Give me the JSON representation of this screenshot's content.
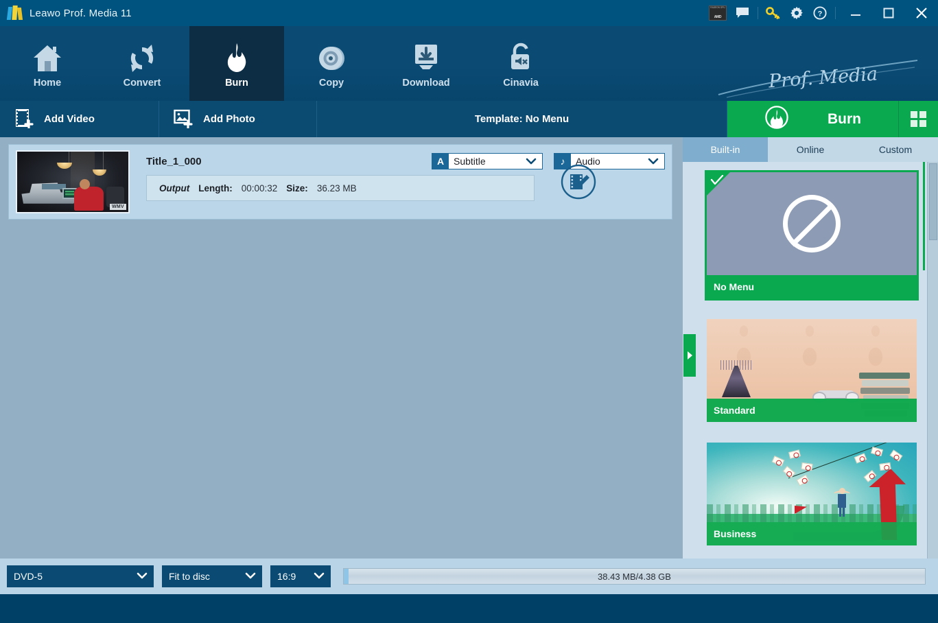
{
  "window": {
    "title": "Leawo Prof. Media 11",
    "logo_icon": "leawo-logo-icon",
    "controls": {
      "amd_badge_top": "RADEON GPU",
      "amd_badge_bottom": "AMD",
      "feedback_icon": "chat-bubble-icon",
      "key_icon": "key-icon",
      "settings_icon": "gear-icon",
      "help_icon": "help-circle-icon",
      "minimize_icon": "minimize-icon",
      "maximize_icon": "maximize-icon",
      "close_icon": "close-icon"
    }
  },
  "nav": {
    "items": [
      {
        "label": "Home",
        "icon": "home-icon",
        "active": false
      },
      {
        "label": "Convert",
        "icon": "convert-refresh-icon",
        "active": false
      },
      {
        "label": "Burn",
        "icon": "flame-icon",
        "active": true
      },
      {
        "label": "Copy",
        "icon": "disc-icon",
        "active": false
      },
      {
        "label": "Download",
        "icon": "download-monitor-icon",
        "active": false
      },
      {
        "label": "Cinavia",
        "icon": "unlock-mute-icon",
        "active": false
      }
    ],
    "brand": "Prof. Media"
  },
  "toolbar": {
    "add_video": "Add Video",
    "add_video_icon": "film-add-icon",
    "add_photo": "Add Photo",
    "add_photo_icon": "image-add-icon",
    "template_status": "Template: No Menu",
    "burn_label": "Burn",
    "burn_icon": "flame-circle-icon",
    "grid_icon": "grid-view-icon"
  },
  "video_item": {
    "title": "Title_1_000",
    "thumbnail_watermark": "WMV",
    "subtitle_select": {
      "badge": "A",
      "value": "Subtitle",
      "icon": "subtitle-icon"
    },
    "audio_select": {
      "badge": "♪",
      "value": "Audio",
      "icon": "audio-note-icon"
    },
    "output_label": "Output",
    "length_label": "Length:",
    "length_value": "00:00:32",
    "size_label": "Size:",
    "size_value": "36.23 MB",
    "edit_icon": "video-edit-icon"
  },
  "panel": {
    "handle_icon": "collapse-panel-arrow-icon",
    "tabs": [
      {
        "label": "Built-in",
        "active": true
      },
      {
        "label": "Online",
        "active": false
      },
      {
        "label": "Custom",
        "active": false
      }
    ],
    "templates": [
      {
        "name": "No Menu",
        "selected": true,
        "art": "nomenu",
        "icon": "no-entry-icon"
      },
      {
        "name": "Standard",
        "selected": false,
        "art": "standard"
      },
      {
        "name": "Business",
        "selected": false,
        "art": "business"
      }
    ]
  },
  "bottom": {
    "disc_type": "DVD-5",
    "fit_mode": "Fit to disc",
    "aspect_ratio": "16:9",
    "capacity_text": "38.43 MB/4.38 GB",
    "capacity_used": "38.43 MB",
    "capacity_total": "4.38 GB",
    "capacity_percent": 0.86
  },
  "colors": {
    "titlebar": "#00537f",
    "nav": "#0a4a73",
    "nav_active": "#0c2d44",
    "accent_green": "#0aa94f",
    "list_bg": "#93afc4",
    "card_bg": "#bbd6e8",
    "panel_bg": "#cfe0ec",
    "bottom_bar": "#b9d4e6",
    "status_bar": "#003f66"
  }
}
